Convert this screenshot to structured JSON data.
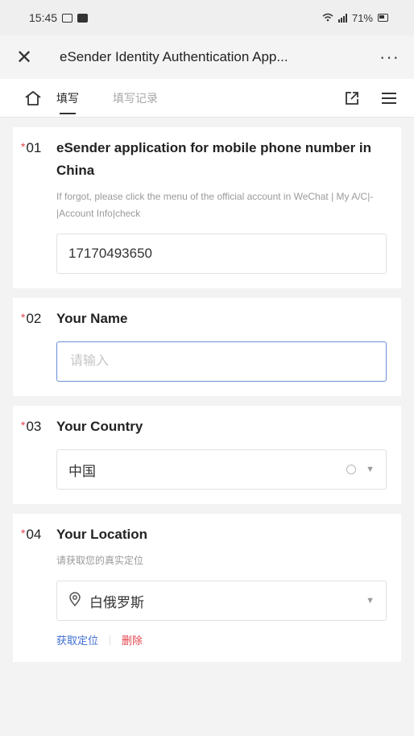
{
  "status": {
    "time": "15:45",
    "indicators": "㊀㊁ .ıl 71%"
  },
  "appbar": {
    "title": "eSender Identity Authentication App...",
    "close_icon": "close-icon",
    "more_label": "···"
  },
  "tabs": {
    "home_icon": "home-icon",
    "fill": "填写",
    "records": "填写记录"
  },
  "questions": [
    {
      "num": "01",
      "title": "eSender application for mobile phone number in China",
      "desc": "If forgot, please click the menu of the official account in WeChat | My A/C|-|Account Info|check",
      "value": "17170493650"
    },
    {
      "num": "02",
      "title": "Your Name",
      "placeholder": "请输入"
    },
    {
      "num": "03",
      "title": "Your Country",
      "value": "中国"
    },
    {
      "num": "04",
      "title": "Your Location",
      "desc": "请获取您的真实定位",
      "value": "白俄罗斯",
      "get_location": "获取定位",
      "delete": "删除"
    }
  ],
  "colors": {
    "required": "#e2434b",
    "link": "#3f6fd1",
    "focus": "#6d8fd6"
  }
}
